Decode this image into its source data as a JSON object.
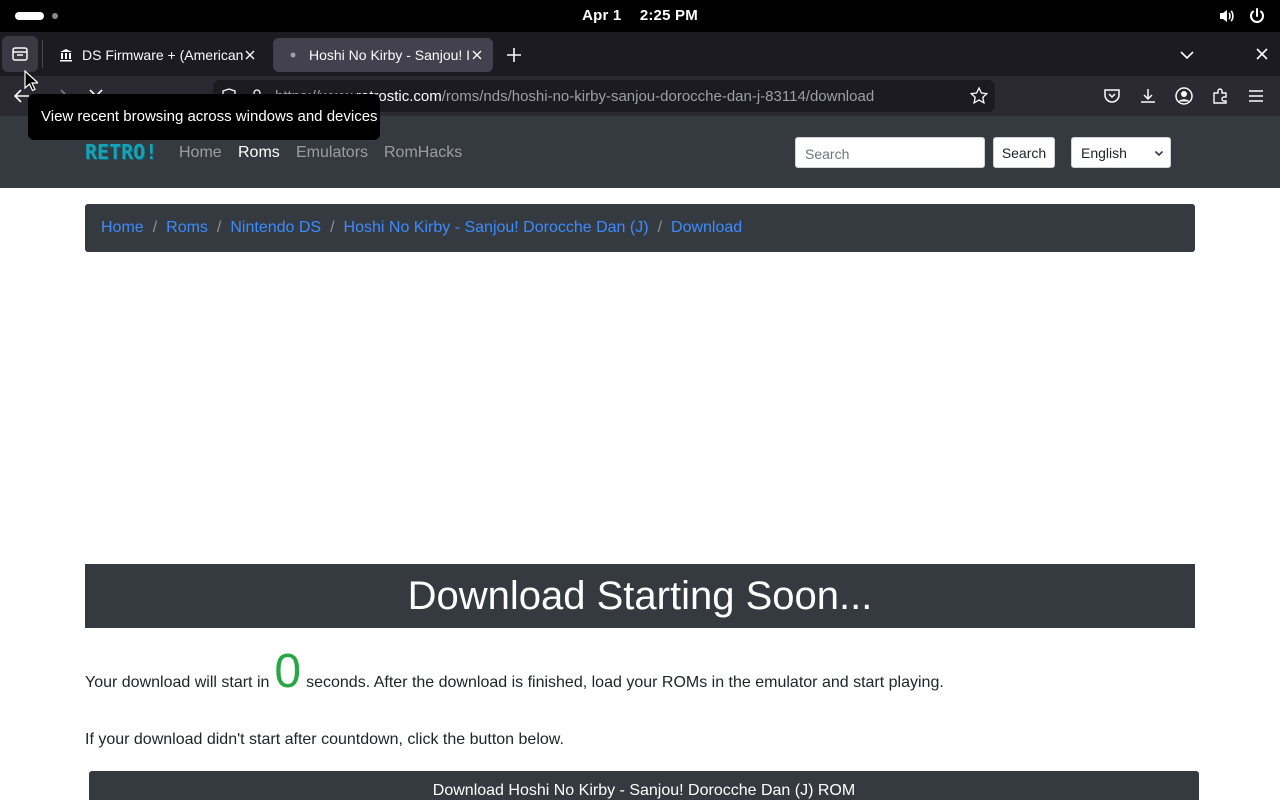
{
  "system": {
    "date": "Apr 1",
    "time": "2:25 PM",
    "icons": [
      "volume-icon",
      "power-icon"
    ]
  },
  "browser": {
    "tabs": [
      {
        "title": "DS Firmware + (American",
        "favicon": "museum-icon",
        "active": false
      },
      {
        "title": "Hoshi No Kirby - Sanjou! I",
        "favicon": "loading-dot-icon",
        "active": true
      }
    ],
    "url": {
      "prefix": "https://www.",
      "domain": "retrostic.com",
      "path": "/roms/nds/hoshi-no-kirby-sanjou-dorocche-dan-j-83114/download"
    },
    "tooltip": "View recent browsing across windows and devices"
  },
  "site": {
    "logo": "RETRO!",
    "nav": [
      {
        "label": "Home",
        "active": false
      },
      {
        "label": "Roms",
        "active": true
      },
      {
        "label": "Emulators",
        "active": false
      },
      {
        "label": "RomHacks",
        "active": false
      }
    ],
    "search_placeholder": "Search",
    "search_button": "Search",
    "language": "English"
  },
  "breadcrumb": [
    "Home",
    "Roms",
    "Nintendo DS",
    "Hoshi No Kirby - Sanjou! Dorocche Dan (J)",
    "Download"
  ],
  "download": {
    "heading": "Download Starting Soon...",
    "countdown_before": "Your download will start in",
    "countdown_value": "0",
    "countdown_after": "seconds. After the download is finished, load your ROMs in the emulator and start playing.",
    "retry_text": "If your download didn't start after countdown, click the button below.",
    "button_label": "Download Hoshi No Kirby - Sanjou! Dorocche Dan (J) ROM"
  },
  "colors": {
    "site_dark": "#343a40",
    "link": "#3d8bfd",
    "countdown": "#28a745",
    "logo": "#17a2b8"
  }
}
